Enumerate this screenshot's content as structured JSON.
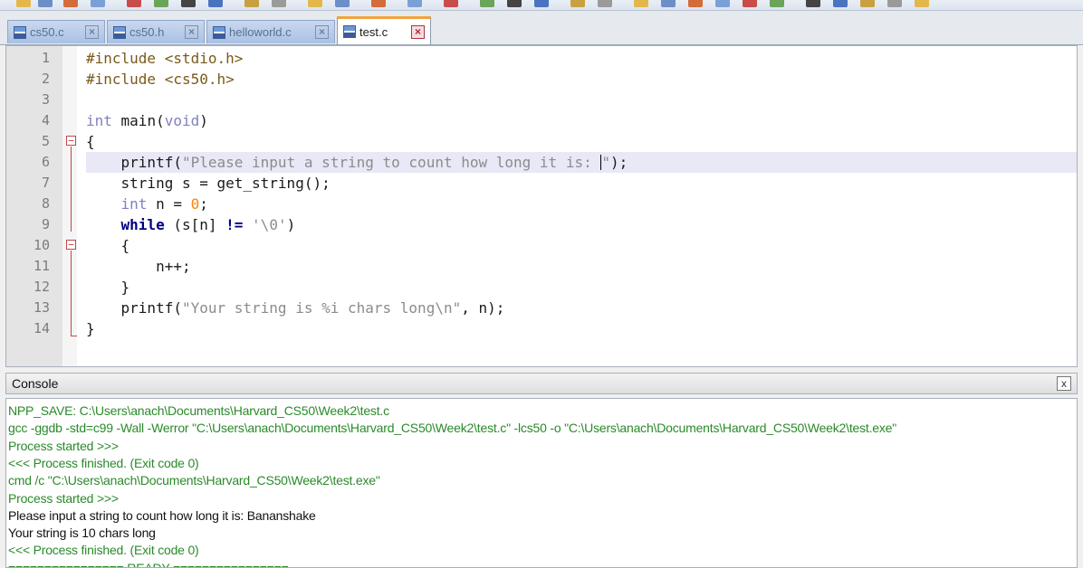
{
  "tabs": [
    {
      "label": "cs50.c",
      "active": false
    },
    {
      "label": "cs50.h",
      "active": false
    },
    {
      "label": "helloworld.c",
      "active": false
    },
    {
      "label": "test.c",
      "active": true
    }
  ],
  "editor": {
    "current_line": 6,
    "lines": [
      {
        "n": "1",
        "tokens": [
          [
            "pre",
            "#include <stdio.h>"
          ]
        ]
      },
      {
        "n": "2",
        "tokens": [
          [
            "pre",
            "#include <cs50.h>"
          ]
        ]
      },
      {
        "n": "3",
        "tokens": []
      },
      {
        "n": "4",
        "tokens": [
          [
            "kw-type",
            "int"
          ],
          [
            "",
            " main("
          ],
          [
            "kw-type",
            "void"
          ],
          [
            "",
            ")"
          ]
        ]
      },
      {
        "n": "5",
        "tokens": [
          [
            "",
            "{"
          ]
        ]
      },
      {
        "n": "6",
        "tokens": [
          [
            "",
            "    printf("
          ],
          [
            "str",
            "\"Please input a string to count how long it is: "
          ],
          [
            "caret",
            ""
          ],
          [
            "str",
            "\""
          ],
          [
            "",
            ");"
          ]
        ]
      },
      {
        "n": "7",
        "tokens": [
          [
            "",
            "    string s = get_string();"
          ]
        ]
      },
      {
        "n": "8",
        "tokens": [
          [
            "",
            "    "
          ],
          [
            "kw-type",
            "int"
          ],
          [
            "",
            " n = "
          ],
          [
            "num",
            "0"
          ],
          [
            "",
            ";"
          ]
        ]
      },
      {
        "n": "9",
        "tokens": [
          [
            "",
            "    "
          ],
          [
            "kw-flow",
            "while"
          ],
          [
            "",
            " (s[n] "
          ],
          [
            "op",
            "!="
          ],
          [
            "",
            " "
          ],
          [
            "str",
            "'\\0'"
          ],
          [
            "",
            ")"
          ]
        ]
      },
      {
        "n": "10",
        "tokens": [
          [
            "",
            "    {"
          ]
        ]
      },
      {
        "n": "11",
        "tokens": [
          [
            "",
            "        n++;"
          ]
        ]
      },
      {
        "n": "12",
        "tokens": [
          [
            "",
            "    }"
          ]
        ]
      },
      {
        "n": "13",
        "tokens": [
          [
            "",
            "    printf("
          ],
          [
            "str",
            "\"Your string is %i chars long\\n\""
          ],
          [
            "",
            ", n);"
          ]
        ]
      },
      {
        "n": "14",
        "tokens": [
          [
            "",
            "}"
          ]
        ]
      }
    ]
  },
  "console": {
    "title": "Console",
    "close_label": "x",
    "lines": [
      {
        "color": "green",
        "text": "NPP_SAVE: C:\\Users\\anach\\Documents\\Harvard_CS50\\Week2\\test.c"
      },
      {
        "color": "green",
        "text": "gcc -ggdb -std=c99 -Wall -Werror \"C:\\Users\\anach\\Documents\\Harvard_CS50\\Week2\\test.c\" -lcs50 -o \"C:\\Users\\anach\\Documents\\Harvard_CS50\\Week2\\test.exe\""
      },
      {
        "color": "green",
        "text": "Process started >>>"
      },
      {
        "color": "green",
        "text": "<<< Process finished. (Exit code 0)"
      },
      {
        "color": "green",
        "text": "cmd /c \"C:\\Users\\anach\\Documents\\Harvard_CS50\\Week2\\test.exe\""
      },
      {
        "color": "green",
        "text": "Process started >>>"
      },
      {
        "color": "black",
        "text": "Please input a string to count how long it is: Bananshake"
      },
      {
        "color": "black",
        "text": "Your string is 10 chars long"
      },
      {
        "color": "green",
        "text": "<<< Process finished. (Exit code 0)"
      },
      {
        "color": "green",
        "text": "================ READY ================"
      }
    ]
  }
}
